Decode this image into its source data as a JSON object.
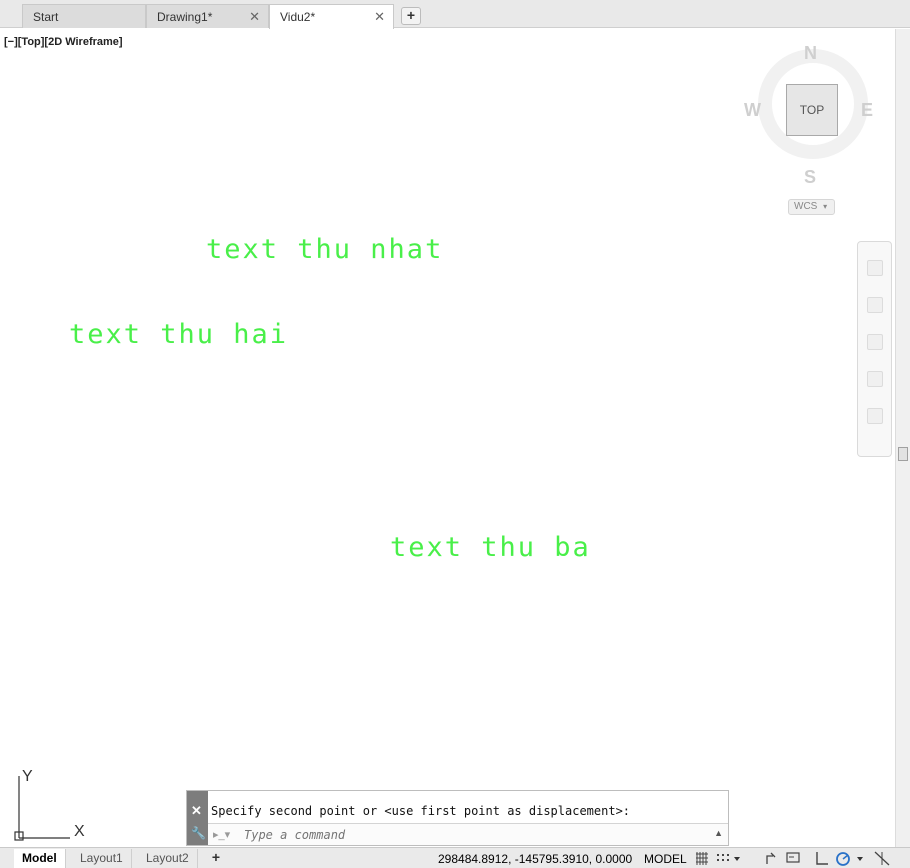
{
  "tabs": [
    {
      "label": "Start",
      "active": false,
      "closable": false
    },
    {
      "label": "Drawing1*",
      "active": false,
      "closable": true
    },
    {
      "label": "Vidu2*",
      "active": true,
      "closable": true
    }
  ],
  "tab_add_label": "+",
  "tab_close_glyph": "✕",
  "viewport": {
    "controls_label": "[−][Top][2D Wireframe]",
    "texts": [
      "text thu nhat",
      "text thu hai",
      "text thu ba"
    ],
    "text_color": "#49ef49"
  },
  "viewcube": {
    "top_label": "TOP",
    "north": "N",
    "south": "S",
    "east": "E",
    "west": "W",
    "wcs_label": "WCS",
    "wcs_arrow": "▾"
  },
  "ucs": {
    "y_label": "Y",
    "x_label": "X"
  },
  "command": {
    "history": "Specify second point or <use first point as displacement>:",
    "input_placeholder": "Type a command",
    "close_glyph": "✕",
    "wrench_glyph": "🔧",
    "prompt_glyph": "▸_▾",
    "up_glyph": "▲"
  },
  "status": {
    "layout_tabs": [
      "Model",
      "Layout1",
      "Layout2"
    ],
    "layout_add": "+",
    "coordinates": "298484.8912, -145795.3910, 0.0000",
    "space": "MODEL"
  },
  "icons": [
    "grid-icon",
    "snap-dropdown-icon",
    "infer-constraints-icon",
    "ortho-icon",
    "polar-icon",
    "polar-dropdown-icon",
    "isodraft-icon"
  ]
}
